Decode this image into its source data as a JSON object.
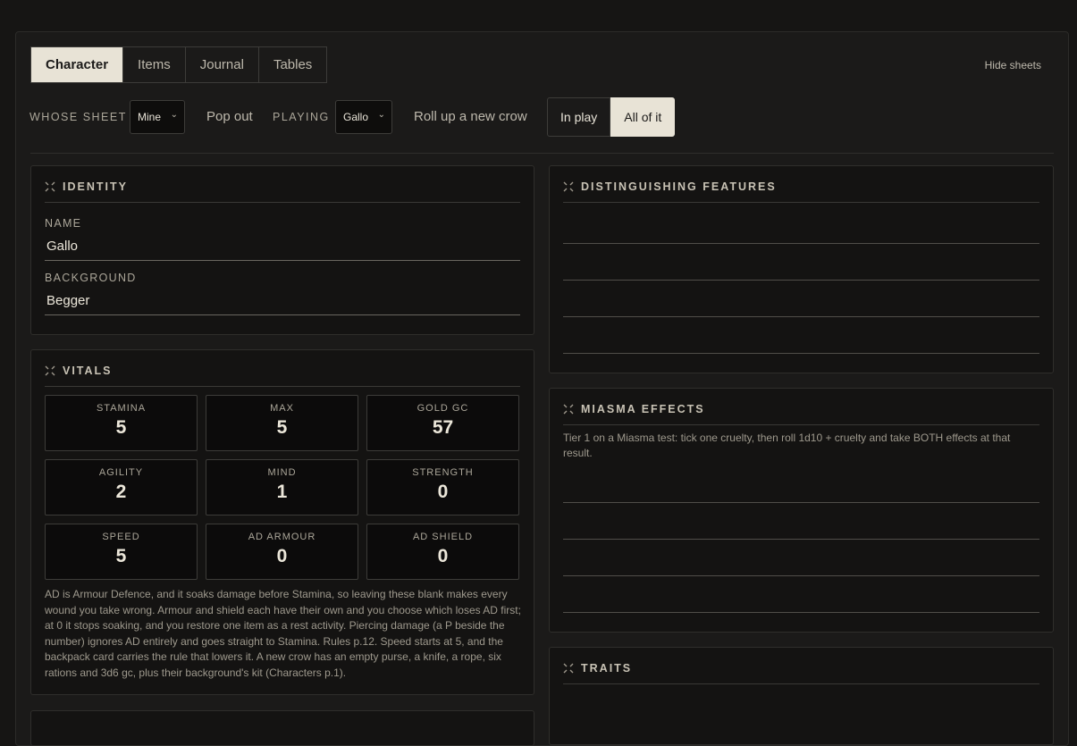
{
  "tabs": [
    "Character",
    "Items",
    "Journal",
    "Tables"
  ],
  "hide_sheets": "Hide sheets",
  "controls": {
    "whose_sheet_label": "WHOSE SHEET",
    "whose_sheet_value": "Mine",
    "pop_out": "Pop out",
    "playing_label": "PLAYING",
    "playing_value": "Gallo",
    "roll_new": "Roll up a new crow",
    "view_in_play": "In play",
    "view_all": "All of it"
  },
  "identity": {
    "title": "IDENTITY",
    "name_label": "NAME",
    "name_value": "Gallo",
    "background_label": "BACKGROUND",
    "background_value": "Begger"
  },
  "vitals": {
    "title": "VITALS",
    "stats": [
      {
        "label": "STAMINA",
        "value": "5"
      },
      {
        "label": "MAX",
        "value": "5"
      },
      {
        "label": "GOLD GC",
        "value": "57"
      },
      {
        "label": "AGILITY",
        "value": "2"
      },
      {
        "label": "MIND",
        "value": "1"
      },
      {
        "label": "STRENGTH",
        "value": "0"
      },
      {
        "label": "SPEED",
        "value": "5"
      },
      {
        "label": "AD ARMOUR",
        "value": "0"
      },
      {
        "label": "AD SHIELD",
        "value": "0"
      }
    ],
    "note": "AD is Armour Defence, and it soaks damage before Stamina, so leaving these blank makes every wound you take wrong. Armour and shield each have their own and you choose which loses AD first; at 0 it stops soaking, and you restore one item as a rest activity. Piercing damage (a P beside the number) ignores AD entirely and goes straight to Stamina. Rules p.12. Speed starts at 5, and the backpack card carries the rule that lowers it. A new crow has an empty purse, a knife, a rope, six rations and 3d6 gc, plus their background's kit (Characters p.1)."
  },
  "features": {
    "title": "DISTINGUISHING FEATURES"
  },
  "miasma": {
    "title": "MIASMA EFFECTS",
    "text": "Tier 1 on a Miasma test: tick one cruelty, then roll 1d10 + cruelty and take BOTH effects at that result."
  },
  "traits": {
    "title": "TRAITS"
  },
  "icons": {
    "panel": "crosshair-icon",
    "select": "chevron-down-icon"
  },
  "colors": {
    "accent": "#e8e3d6",
    "background": "#161514",
    "panel": "#141312"
  }
}
